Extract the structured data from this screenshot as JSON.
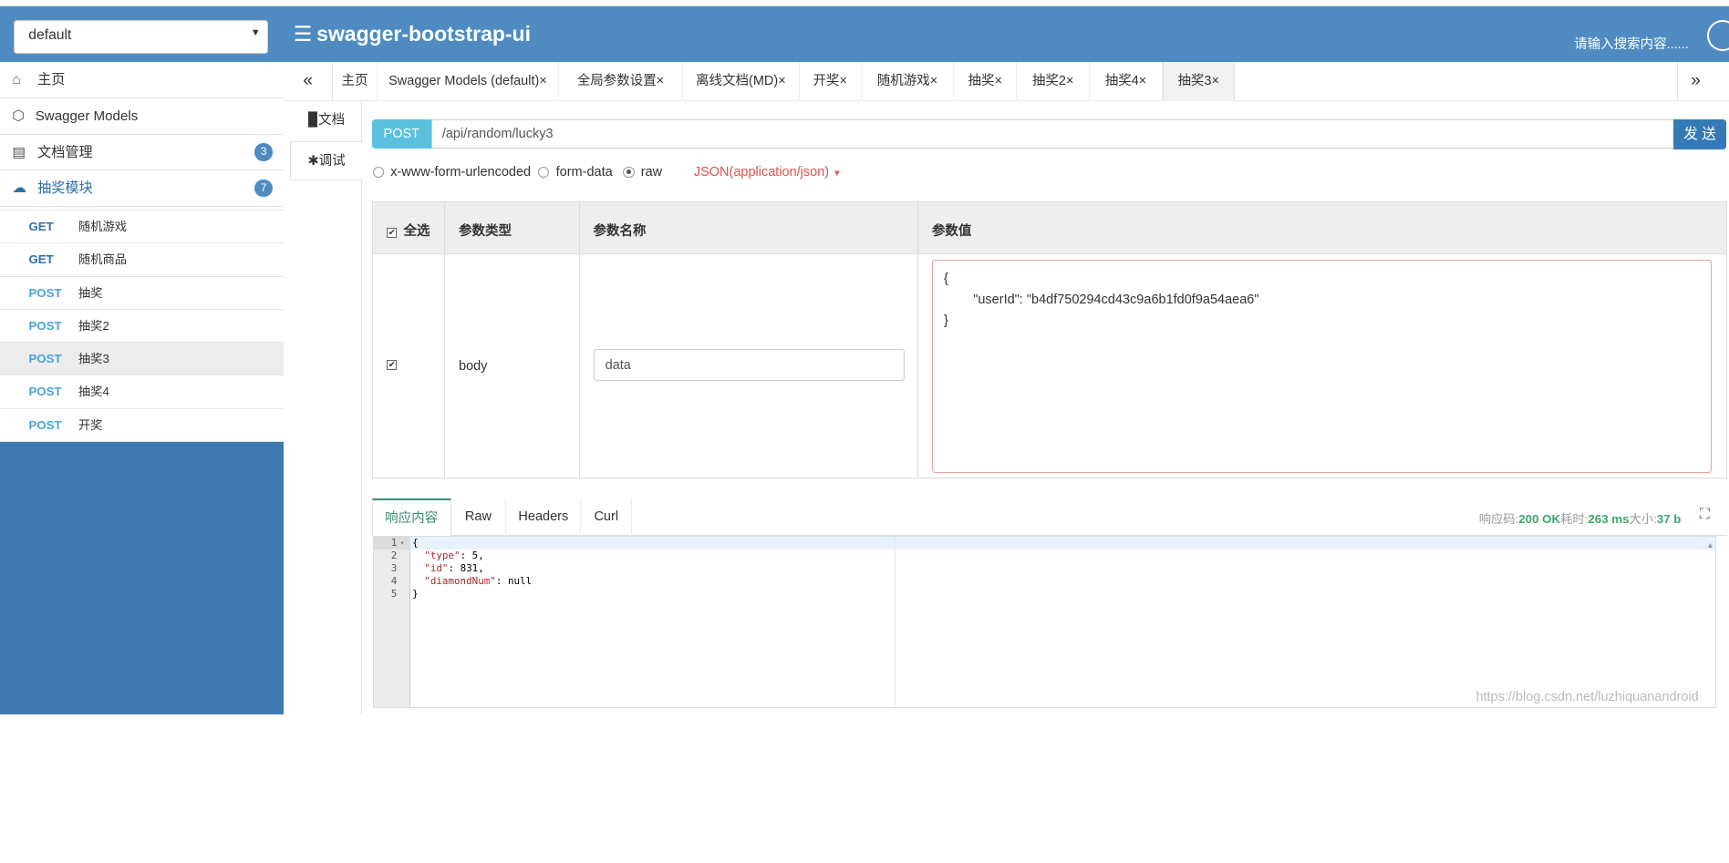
{
  "header": {
    "group_select": "default",
    "brand": "swagger-bootstrap-ui",
    "search_placeholder": "请输入搜索内容......"
  },
  "sidebar": {
    "items": [
      {
        "label": "主页",
        "icon": "home-icon"
      },
      {
        "label": "Swagger Models",
        "icon": "cube-icon"
      },
      {
        "label": "文档管理",
        "icon": "doc-settings-icon",
        "badge": "3"
      },
      {
        "label": "抽奖模块",
        "icon": "cloud-icon",
        "badge": "7"
      }
    ],
    "apis": [
      {
        "method": "GET",
        "label": "随机游戏"
      },
      {
        "method": "GET",
        "label": "随机商品"
      },
      {
        "method": "POST",
        "label": "抽奖"
      },
      {
        "method": "POST",
        "label": "抽奖2"
      },
      {
        "method": "POST",
        "label": "抽奖3"
      },
      {
        "method": "POST",
        "label": "抽奖4"
      },
      {
        "method": "POST",
        "label": "开奖"
      }
    ]
  },
  "tabs": {
    "nav_left": "«",
    "nav_right": "»",
    "items": [
      "主页",
      "Swagger Models (default)×",
      "全局参数设置×",
      "离线文档(MD)×",
      "开奖×",
      "随机游戏×",
      "抽奖×",
      "抽奖2×",
      "抽奖4×",
      "抽奖3×"
    ]
  },
  "vtabs": {
    "doc": "文档",
    "debug": "调试"
  },
  "request": {
    "method": "POST",
    "url": "/api/random/lucky3",
    "send": "发 送"
  },
  "body_types": {
    "urlencoded": "x-www-form-urlencoded",
    "formdata": "form-data",
    "raw": "raw",
    "content_type": "JSON(application/json)"
  },
  "params_table": {
    "headers": {
      "select_all": "全选",
      "type": "参数类型",
      "name": "参数名称",
      "value": "参数值"
    },
    "row": {
      "type": "body",
      "name": "data"
    },
    "value_lines": [
      "{",
      "        \"userId\": \"b4df750294cd43c9a6b1fd0f9a54aea6\"",
      "}"
    ]
  },
  "response": {
    "tabs": [
      "响应内容",
      "Raw",
      "Headers",
      "Curl"
    ],
    "meta": {
      "code_label": "响应码:",
      "code": "200 OK",
      "time_label": "耗时:",
      "time": "263 ms",
      "size_label": "大小:",
      "size": "37 b"
    },
    "gutter": [
      "1",
      "2",
      "3",
      "4",
      "5"
    ],
    "code": [
      {
        "key": "",
        "value": "{"
      },
      {
        "key": "  \"type\"",
        "value": ": 5,"
      },
      {
        "key": "  \"id\"",
        "value": ": 831,"
      },
      {
        "key": "  \"diamondNum\"",
        "value": ": null"
      },
      {
        "key": "",
        "value": "}"
      }
    ]
  },
  "watermark": "https://blog.csdn.net/luzhiquanandroid"
}
